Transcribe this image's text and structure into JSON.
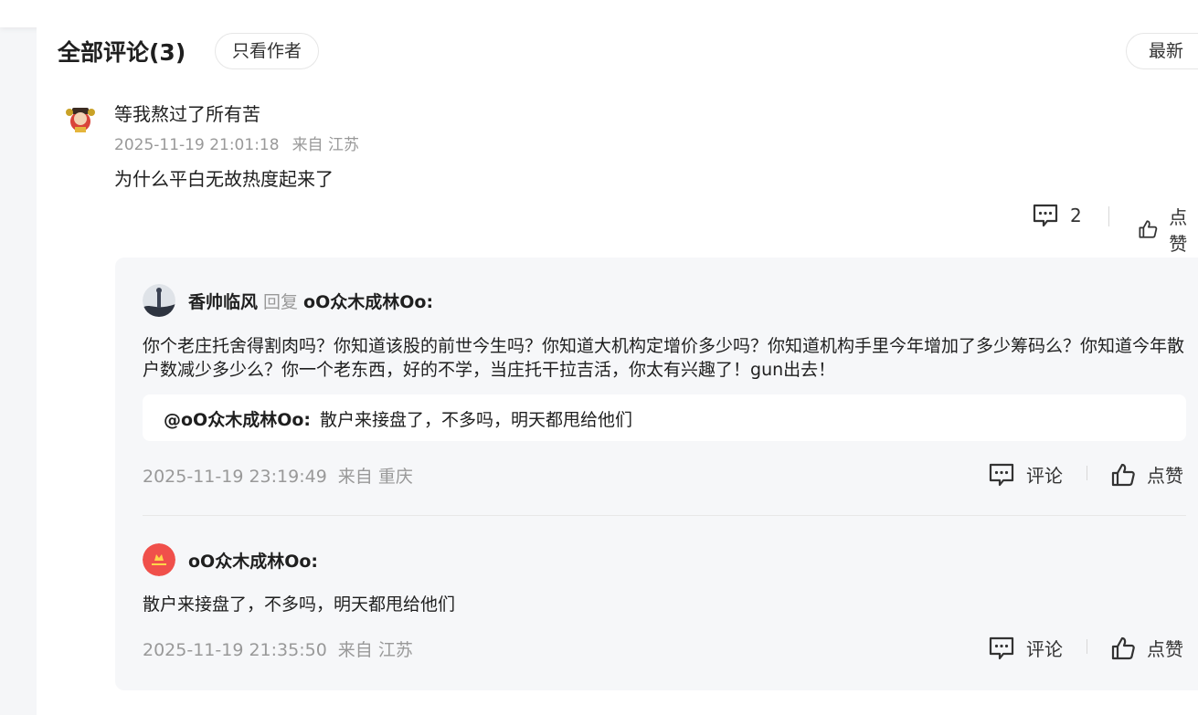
{
  "header": {
    "title": "全部评论(3)",
    "only_author_label": "只看作者",
    "sort_label": "最新"
  },
  "main_comment": {
    "username": "等我熬过了所有苦",
    "time": "2025-11-19 21:01:18",
    "location": "来自 江苏",
    "content": "为什么平白无故热度起来了",
    "comment_count": "2",
    "like_label": "点赞"
  },
  "replies": [
    {
      "username": "香帅临风",
      "reply_word": "回复",
      "reply_to": "oO众木成林Oo:",
      "content": "你个老庄托舍得割肉吗？你知道该股的前世今生吗？你知道大机构定增价多少吗？你知道机构手里今年增加了多少筹码么？你知道今年散户数减少多少么？你一个老东西，好的不学，当庄托干拉吉活，你太有兴趣了！gun出去！",
      "quote_user": "@oO众木成林Oo:",
      "quote_text": "散户来接盘了，不多吗，明天都甩给他们",
      "time": "2025-11-19 23:19:49",
      "location": "来自 重庆",
      "comment_label": "评论",
      "like_label": "点赞"
    },
    {
      "username": "oO众木成林Oo:",
      "content": "散户来接盘了，不多吗，明天都甩给他们",
      "time": "2025-11-19 21:35:50",
      "location": "来自 江苏",
      "comment_label": "评论",
      "like_label": "点赞"
    }
  ],
  "colors": {
    "text_main": "#1f1f1f",
    "text_muted": "#999999",
    "reply_bg": "#f6f7f9",
    "avatar_red": "#f0504b"
  }
}
